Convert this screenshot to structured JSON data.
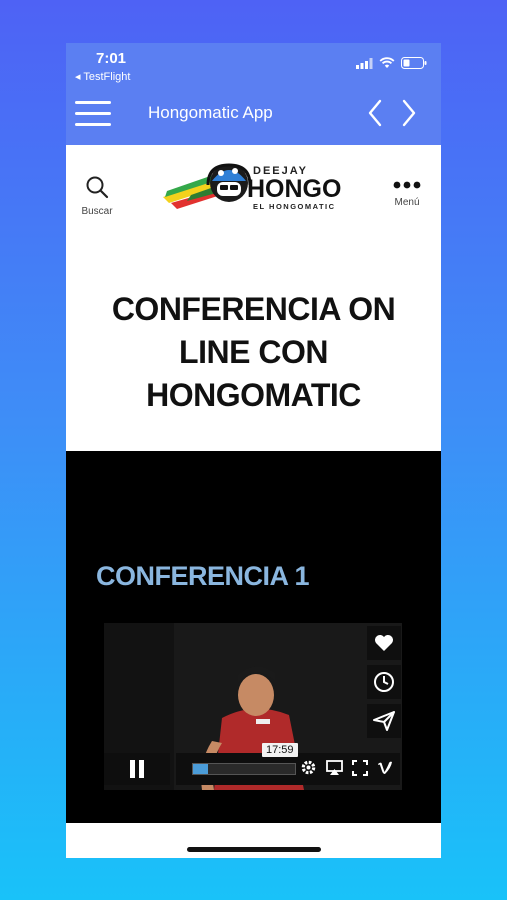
{
  "status": {
    "time": "7:01",
    "back_app": "◂ TestFlight"
  },
  "nav": {
    "title": "Hongomatic App"
  },
  "header": {
    "search_label": "Buscar",
    "menu_label": "Menú",
    "logo": {
      "top": "DEEJAY",
      "main": "HONGO",
      "sub": "EL HONGOMATIC"
    }
  },
  "page": {
    "title_line1": "CONFERENCIA ON",
    "title_line2": "LINE CON",
    "title_line3": "HONGOMATIC"
  },
  "section": {
    "heading": "CONFERENCIA 1"
  },
  "video": {
    "time": "17:59",
    "progress": 0.15
  },
  "colors": {
    "nav_bg": "#5b7ff2",
    "heading_blue": "#8ab6df",
    "progress_blue": "#4b9cd8"
  }
}
